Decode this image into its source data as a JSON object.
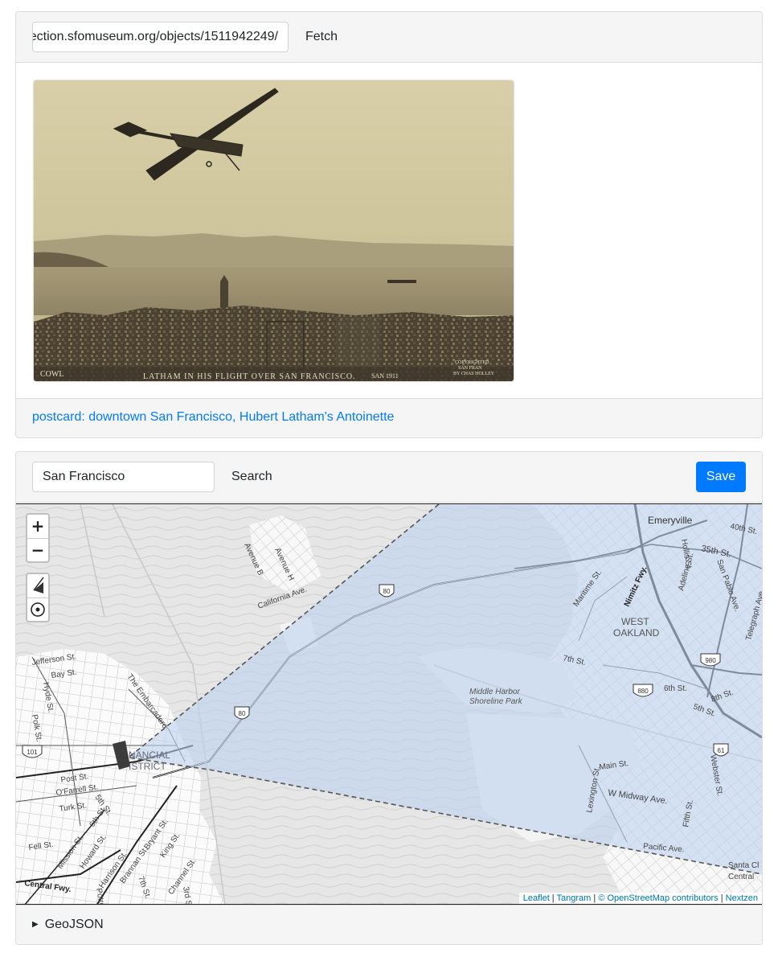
{
  "fetch": {
    "url_value": "https://collection.sfomuseum.org/objects/1511942249/",
    "button_label": "Fetch"
  },
  "photo": {
    "caption_text": "LATHAM IN HIS FLIGHT OVER SAN FRANCISCO.",
    "caption_left": "COWL",
    "caption_date": "SAN 1911",
    "copyright_text": "COPYRIGHTED",
    "copyright_line2": "SAN FRAN",
    "copyright_line3": "BY CHAS HOLLEY"
  },
  "object_link": {
    "label": "postcard: downtown San Francisco, Hubert Latham's Antoinette"
  },
  "search": {
    "query_value": "San Francisco",
    "button_label": "Search",
    "save_label": "Save"
  },
  "map": {
    "zoom_in_label": "+",
    "zoom_out_label": "−",
    "fov_color": "#bcd2ee",
    "labels": {
      "emeryville": "Emeryville",
      "west_oakland_1": "WEST",
      "west_oakland_2": "OAKLAND",
      "middle_harbor_1": "Middle Harbor",
      "middle_harbor_2": "Shoreline Park",
      "financial_1": "NANCIAL",
      "financial_2": "ISTRICT",
      "avenue_b": "Avenue B",
      "avenue_h": "Avenue H",
      "california_ave": "California Ave.",
      "jefferson": "Jefferson St.",
      "bay_st": "Bay St.",
      "embarcadero": "The Embarcadero",
      "hyde": "Hyde St.",
      "polk": "Polk St.",
      "post": "Post St.",
      "ofarrell": "O'Farrell St.",
      "turk": "Turk St.",
      "fifth": "5th St.",
      "sixth": "6th St.",
      "bryant": "Bryant St.",
      "mission": "Mission St.",
      "howard": "Howard St.",
      "harrison": "Harrison St.",
      "brannan": "Brannan St.",
      "king": "King St.",
      "channel": "Channel St.",
      "third": "3rd St.",
      "seventh_sf": "7th St.",
      "fell": "Fell St.",
      "central_fwy": "Central Fwy.",
      "potrero": "Potre",
      "maritime": "Maritime St.",
      "nimitz": "Nimitz Fwy.",
      "hollis": "Hollis St.",
      "adeline": "Adeline St.",
      "san_pablo": "San Pablo Ave.",
      "telegraph": "Telegraph Ave.",
      "fortieth": "40th St.",
      "thirty_fifth": "35th St.",
      "seventh_oak": "7th St.",
      "sixth_oak": "6th St.",
      "fifth_oak": "5th St.",
      "eighth_oak": "8th St.",
      "main_st": "Main St.",
      "w_midway": "W Midway Ave.",
      "lexington": "Lexington St.",
      "fifth_st_alameda": "Fifth St.",
      "webster": "Webster St.",
      "pacific": "Pacific Ave.",
      "santa_cl": "Santa Cl",
      "central_ala": "Central",
      "shield_80_a": "80",
      "shield_80_b": "80",
      "shield_101": "101",
      "shield_980": "980",
      "shield_880": "880",
      "shield_61": "61"
    },
    "attribution": {
      "leaflet": "Leaflet",
      "tangram": "Tangram",
      "osm": "© OpenStreetMap contributors",
      "nextzen": "Nextzen",
      "sep1": " | ",
      "sep2": " | ",
      "sep3": " | "
    }
  },
  "details": {
    "summary_label": "GeoJSON"
  }
}
